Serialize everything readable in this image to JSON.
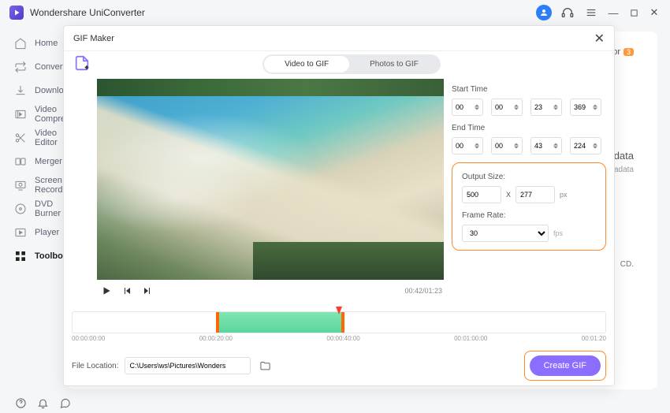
{
  "app": {
    "title": "Wondershare UniConverter"
  },
  "sidebar": {
    "items": [
      {
        "label": "Home"
      },
      {
        "label": "Converter"
      },
      {
        "label": "Downloader"
      },
      {
        "label": "Video Compressor"
      },
      {
        "label": "Video Editor"
      },
      {
        "label": "Merger"
      },
      {
        "label": "Screen Recorder"
      },
      {
        "label": "DVD Burner"
      },
      {
        "label": "Player"
      },
      {
        "label": "Toolbox"
      }
    ]
  },
  "main": {
    "right_hint": "tor",
    "badge": "3",
    "float1": "data",
    "float2": "etadata",
    "float3": "CD."
  },
  "modal": {
    "title": "GIF Maker",
    "tabs": {
      "video": "Video to GIF",
      "photos": "Photos to GIF"
    },
    "times": {
      "start_label": "Start Time",
      "end_label": "End Time",
      "start": [
        "00",
        "00",
        "23",
        "369"
      ],
      "end": [
        "00",
        "00",
        "43",
        "224"
      ]
    },
    "output": {
      "size_label": "Output Size:",
      "w": "500",
      "h": "277",
      "x": "X",
      "px": "px",
      "framerate_label": "Frame Rate:",
      "framerate": "30",
      "fps": "fps"
    },
    "preview_time": "00:42/01:23",
    "timeline": {
      "ticks": [
        "00:00:00:00",
        "00:00:20:00",
        "00:00:40:00",
        "00:01:00:00",
        "00:01:20"
      ],
      "clip_left_pct": 27,
      "clip_width_pct": 24,
      "playhead_pct": 50
    },
    "location": {
      "label": "File Location:",
      "value": "C:\\Users\\ws\\Pictures\\Wonders"
    },
    "create": "Create GIF"
  }
}
